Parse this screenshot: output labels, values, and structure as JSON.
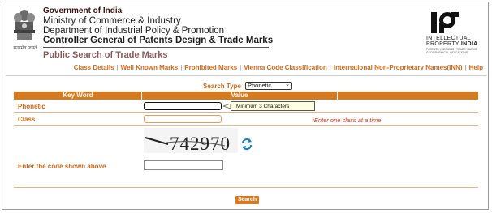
{
  "header": {
    "gov": "Government of India",
    "ministry": "Ministry of Commerce & Industry",
    "department": "Department of Industrial Policy & Promotion",
    "controller": "Controller General of Patents Design & Trade Marks",
    "subtitle": "Public Search of Trade Marks",
    "emblem_caption": "सत्यमेव जयते",
    "ip_logo": {
      "line1": "INTELLECTUAL",
      "line2_prefix": "PROPERTY",
      "line2_bold": "INDIA",
      "line3": "PATENTS | DESIGNS | TRADE MARKS GEOGRAPHICAL INDICATIONS"
    }
  },
  "nav": {
    "items": [
      "Class Details",
      "Well Known Marks",
      "Prohibited Marks",
      "Vienna Code Classification",
      "International Non-Proprietary Names(INN)",
      "Help"
    ]
  },
  "search_type": {
    "label": "Search Type :",
    "selected": "Phonetic"
  },
  "table": {
    "col_keyword": "Key Word",
    "col_value": "Value",
    "phonetic_label": "Phonetic",
    "class_label": "Class",
    "tooltip": "Minimum 3 Characters",
    "class_note": "*Enter one class at a time"
  },
  "captcha": {
    "text": "742970",
    "code_label": "Enter the code shown above"
  },
  "search_button": "Search",
  "colors": {
    "accent": "#d77a1f",
    "label": "#c8691b",
    "error": "#d8321a"
  }
}
